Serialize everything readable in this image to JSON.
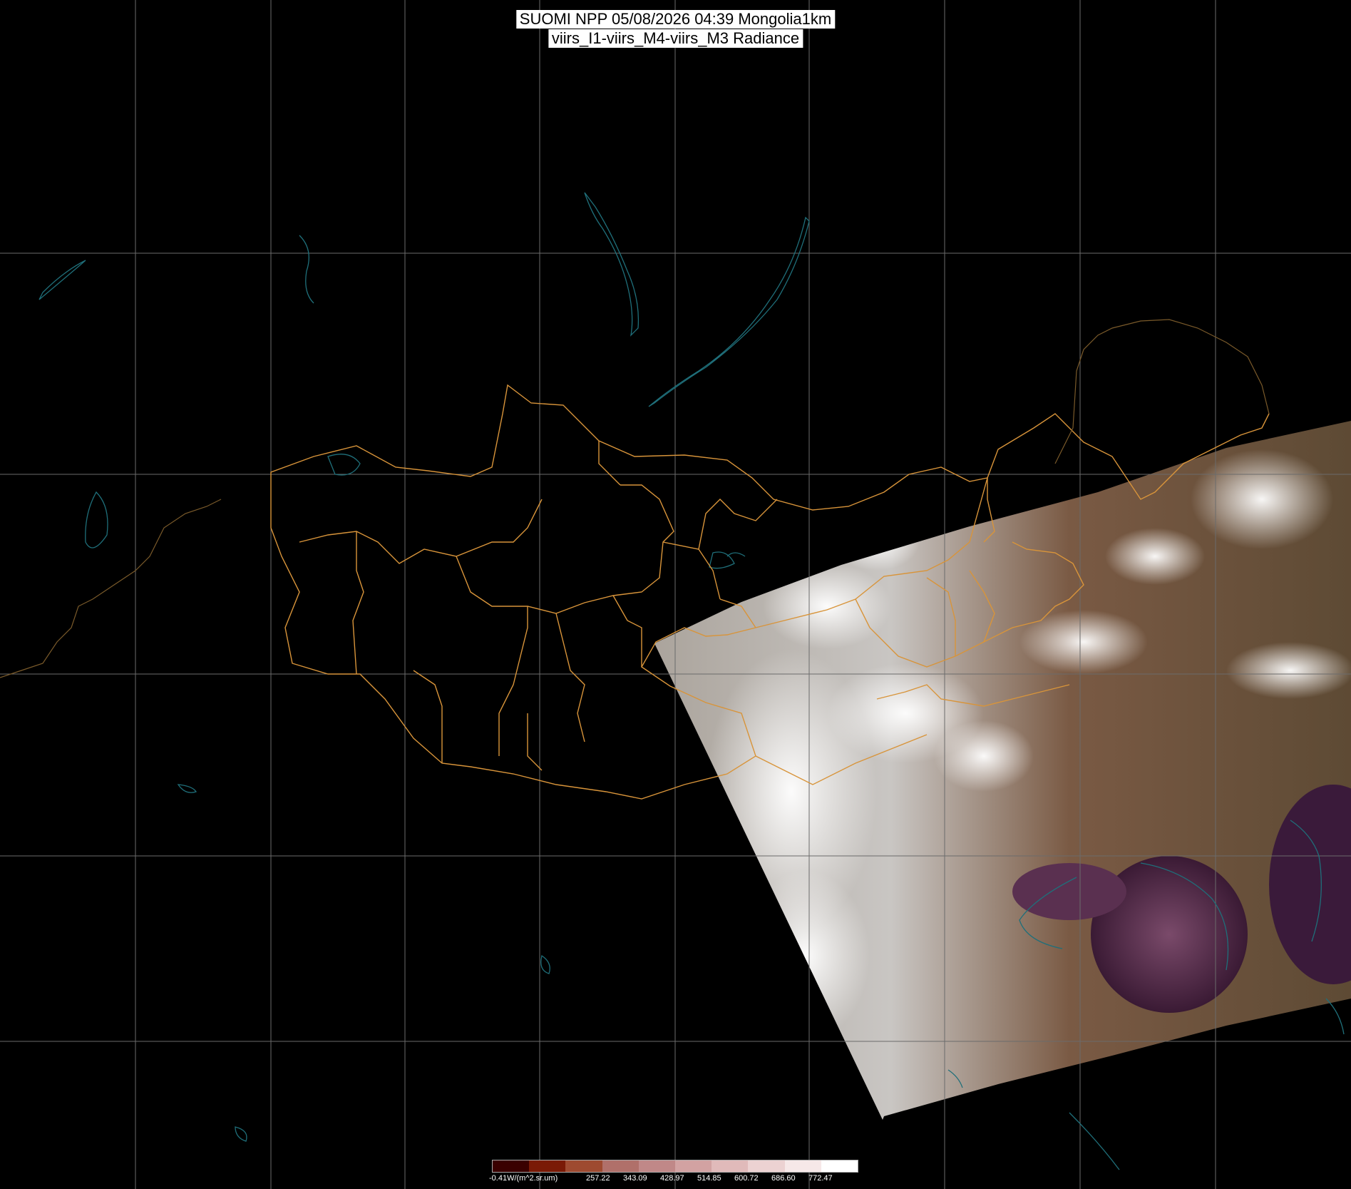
{
  "header": {
    "title_line_1": "SUOMI NPP 05/08/2026 04:39 Mongolia1km",
    "title_line_2": "viirs_I1-viirs_M4-viirs_M3 Radiance"
  },
  "colors": {
    "background": "#000000",
    "grid": "#6b6b6b",
    "borders": "#d8943a",
    "coast": "#1f6f7a"
  },
  "colorbar": {
    "colors": [
      "#3a0000",
      "#7a1a06",
      "#9e4a30",
      "#b0706a",
      "#c08888",
      "#d2a2a2",
      "#e0baba",
      "#ecd2d2",
      "#f6e8e8",
      "#ffffff"
    ],
    "labels": [
      "-0.41W/(m^2.sr.um)",
      "257.22",
      "343.09",
      "428.97",
      "514.85",
      "600.72",
      "686.60",
      "772.47"
    ]
  }
}
